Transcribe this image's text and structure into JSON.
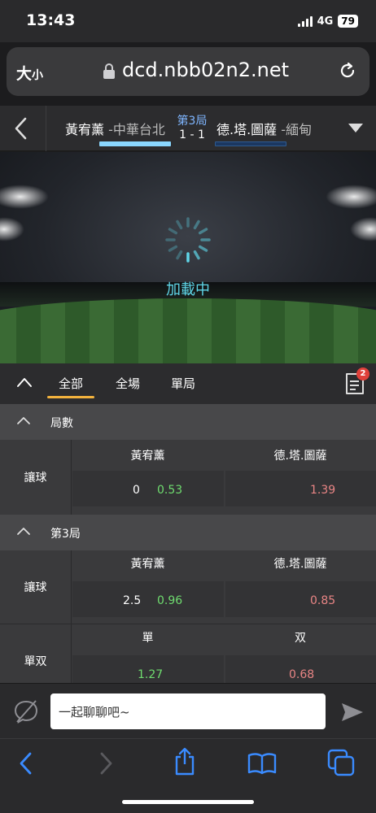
{
  "status": {
    "time": "13:43",
    "network": "4G",
    "battery": "79"
  },
  "browser": {
    "text_size_label": "大",
    "text_size_small": "小",
    "url": "dcd.nbb02n2.net"
  },
  "match": {
    "team_left_name": "黃宥薰",
    "team_left_country": "-中華台北",
    "team_right_name": "德.塔.圖薩",
    "team_right_country": "-緬甸",
    "round": "第3局",
    "score": "1 - 1"
  },
  "video": {
    "loading_text": "加載中"
  },
  "tabs": [
    {
      "label": "全部",
      "active": true
    },
    {
      "label": "全場",
      "active": false
    },
    {
      "label": "單局",
      "active": false
    }
  ],
  "betslip_count": "2",
  "sections": [
    {
      "title": "局數",
      "markets": [
        {
          "label": "讓球",
          "home_name": "黃宥薰",
          "away_name": "德.塔.圖薩",
          "home_line": "0",
          "home_odds": "0.53",
          "away_odds": "1.39"
        }
      ]
    },
    {
      "title": "第3局",
      "markets": [
        {
          "label": "讓球",
          "home_name": "黃宥薰",
          "away_name": "德.塔.圖薩",
          "home_line": "2.5",
          "home_odds": "0.96",
          "away_odds": "0.85"
        },
        {
          "label": "單双",
          "home_name": "單",
          "away_name": "双",
          "home_odds": "1.27",
          "away_odds": "0.68"
        }
      ]
    }
  ],
  "chat": {
    "placeholder": "一起聊聊吧~"
  },
  "colors": {
    "accent_underline": "#f3b33d",
    "odds_up": "#6fdc6f",
    "odds_down": "#e98585",
    "round_label": "#7fb6ff",
    "loading": "#5fd6e8"
  }
}
